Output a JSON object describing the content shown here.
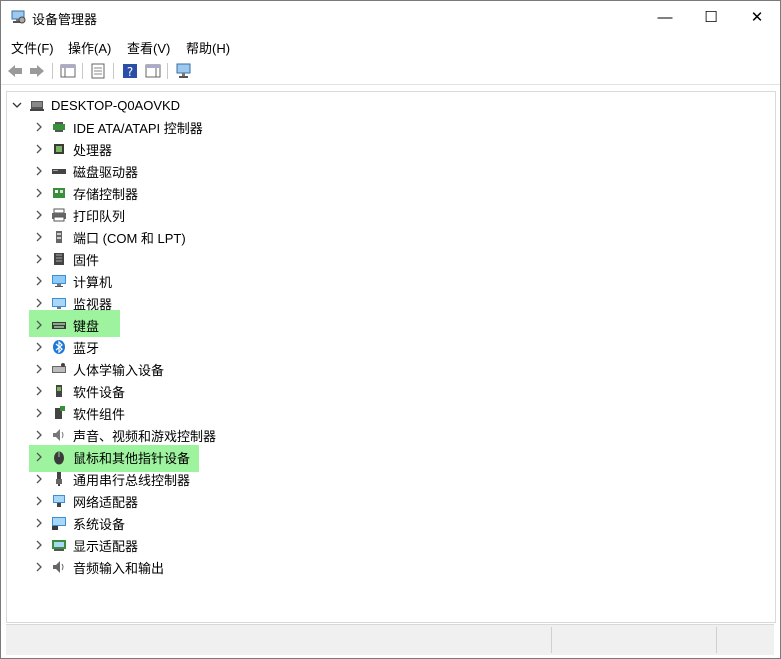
{
  "window": {
    "title": "设备管理器",
    "minimize_glyph": "—",
    "maximize_glyph": "☐",
    "close_glyph": "✕"
  },
  "menu": [
    "文件(F)",
    "操作(A)",
    "查看(V)",
    "帮助(H)"
  ],
  "toolbar": {
    "buttons": [
      "back-icon",
      "forward-icon",
      "properties-pane-icon",
      "list-icon",
      "help-icon",
      "view-icon",
      "monitor-scan-icon"
    ]
  },
  "tree": {
    "root": "DESKTOP-Q0AOVKD",
    "items": [
      {
        "label": "IDE ATA/ATAPI 控制器",
        "icon": "ide-controller-icon"
      },
      {
        "label": "处理器",
        "icon": "processor-icon"
      },
      {
        "label": "磁盘驱动器",
        "icon": "disk-drive-icon"
      },
      {
        "label": "存储控制器",
        "icon": "storage-controller-icon"
      },
      {
        "label": "打印队列",
        "icon": "printer-icon"
      },
      {
        "label": "端口 (COM 和 LPT)",
        "icon": "port-icon"
      },
      {
        "label": "固件",
        "icon": "firmware-icon"
      },
      {
        "label": "计算机",
        "icon": "computer-icon"
      },
      {
        "label": "监视器",
        "icon": "monitor-icon"
      },
      {
        "label": "键盘",
        "icon": "keyboard-icon",
        "highlighted": true
      },
      {
        "label": "蓝牙",
        "icon": "bluetooth-icon"
      },
      {
        "label": "人体学输入设备",
        "icon": "hid-icon"
      },
      {
        "label": "软件设备",
        "icon": "software-device-icon"
      },
      {
        "label": "软件组件",
        "icon": "software-component-icon"
      },
      {
        "label": "声音、视频和游戏控制器",
        "icon": "speaker-icon"
      },
      {
        "label": "鼠标和其他指针设备",
        "icon": "mouse-icon",
        "highlighted": true
      },
      {
        "label": "通用串行总线控制器",
        "icon": "usb-icon"
      },
      {
        "label": "网络适配器",
        "icon": "network-adapter-icon"
      },
      {
        "label": "系统设备",
        "icon": "system-device-icon"
      },
      {
        "label": "显示适配器",
        "icon": "display-adapter-icon"
      },
      {
        "label": "音频输入和输出",
        "icon": "audio-io-icon"
      }
    ]
  },
  "colors": {
    "highlight": "#7ef07e",
    "accent": "#1e78d7"
  }
}
